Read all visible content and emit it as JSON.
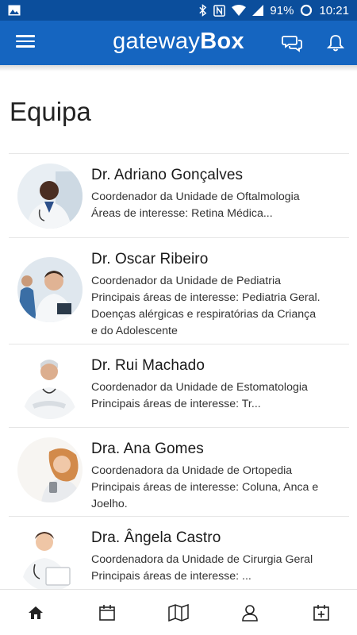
{
  "status_bar": {
    "battery": "91%",
    "time": "10:21",
    "icons": [
      "image-icon",
      "bluetooth-icon",
      "nfc-icon",
      "wifi-icon",
      "signal-icon",
      "battery-icon"
    ]
  },
  "app_bar": {
    "brand_light": "gateway",
    "brand_bold": "Box",
    "icons": [
      "menu-icon",
      "chat-icon",
      "bell-icon"
    ],
    "color": "#1565c0"
  },
  "page": {
    "title": "Equipa"
  },
  "team": [
    {
      "name": "Dr. Adriano Gonçalves",
      "lines": [
        "Coordenador da Unidade de Oftalmologia",
        "Áreas de interesse: Retina Médica..."
      ]
    },
    {
      "name": "Dr. Oscar Ribeiro",
      "lines": [
        "Coordenador da Unidade de Pediatria",
        "Principais áreas de interesse: Pediatria Geral.",
        "Doenças alérgicas e respiratórias da Criança",
        "e do Adolescente"
      ]
    },
    {
      "name": "Dr. Rui Machado",
      "lines": [
        "Coordenador da Unidade de Estomatologia",
        "Principais áreas de interesse: Tr..."
      ]
    },
    {
      "name": "Dra. Ana Gomes",
      "lines": [
        "Coordenadora da Unidade de Ortopedia",
        "Principais áreas de interesse: Coluna, Anca e",
        "Joelho."
      ]
    },
    {
      "name": "Dra. Ângela Castro",
      "lines": [
        "Coordenadora da Unidade de Cirurgia Geral",
        "Principais áreas de interesse: ..."
      ]
    }
  ],
  "bottom_nav": {
    "items": [
      "home-icon",
      "calendar-icon",
      "map-icon",
      "user-icon",
      "calendar-add-icon"
    ]
  }
}
